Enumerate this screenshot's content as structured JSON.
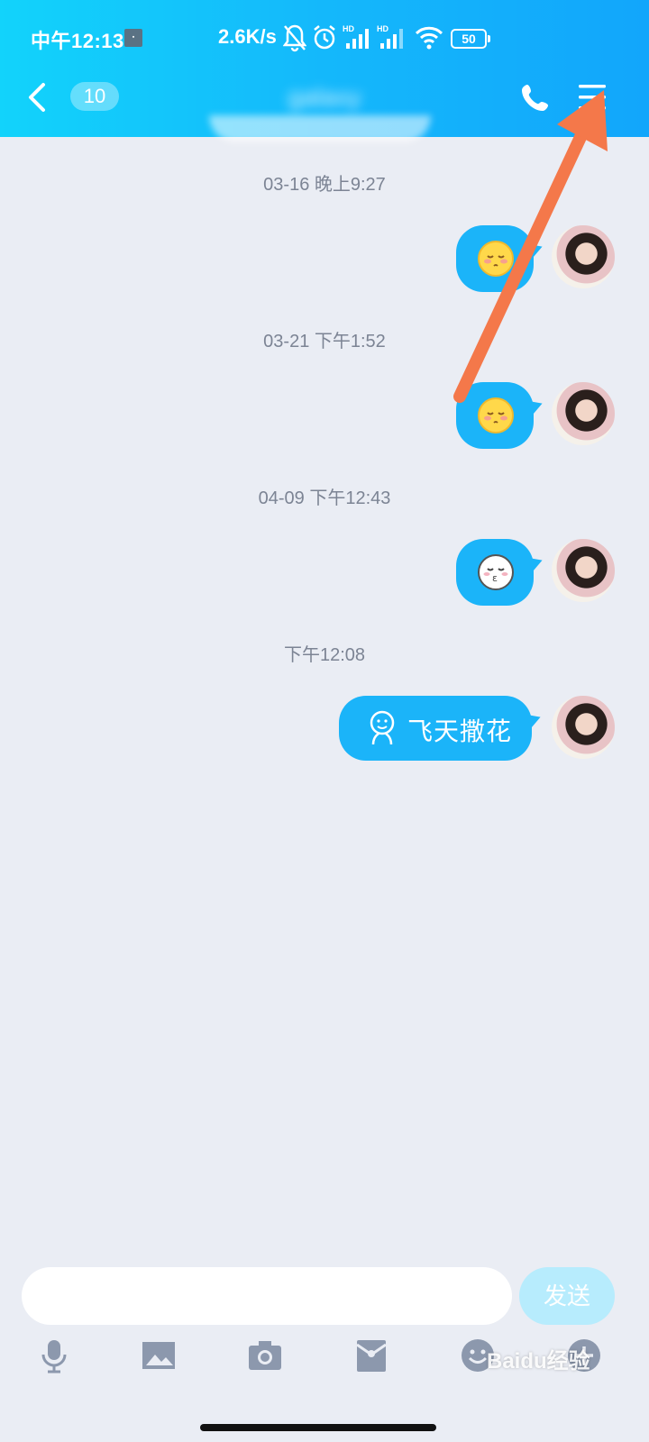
{
  "status_bar": {
    "time": "中午12:13",
    "speed": "2.6K/s",
    "battery": "50",
    "icons": [
      "notification-off-icon",
      "alarm-icon",
      "signal-hd-icon",
      "signal-hd-icon",
      "wifi-icon",
      "battery-icon"
    ]
  },
  "nav": {
    "unread_count": "10",
    "contact_name": "galaxy"
  },
  "messages": [
    {
      "timestamp": "03-16 晚上9:27",
      "content_type": "emoji",
      "emoji": "shy-face-icon"
    },
    {
      "timestamp": "03-21 下午1:52",
      "content_type": "emoji",
      "emoji": "shy-face-icon"
    },
    {
      "timestamp": "04-09 下午12:43",
      "content_type": "emoji",
      "emoji": "kiss-face-icon"
    },
    {
      "timestamp": "下午12:08",
      "content_type": "sticker-text",
      "text": "飞天撒花"
    }
  ],
  "input": {
    "placeholder": "",
    "send_label": "发送"
  },
  "toolbar": [
    "microphone-icon",
    "image-icon",
    "camera-icon",
    "red-packet-icon",
    "emoji-icon",
    "plus-icon"
  ],
  "watermark": "Baidu经验",
  "colors": {
    "header_start": "#12d3fb",
    "header_end": "#12a6fb",
    "bubble": "#1bb4f9",
    "background": "#eaedf4",
    "send_disabled": "#b7ecfd",
    "arrow": "#f4784a"
  }
}
